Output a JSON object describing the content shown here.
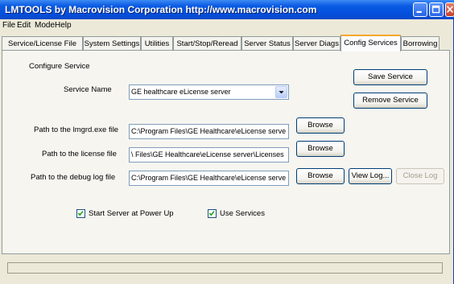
{
  "window": {
    "title": "LMTOOLS by Macrovision Corporation http://www.macrovision.com"
  },
  "menu": [
    "File",
    "Edit",
    "Mode",
    "Help"
  ],
  "tabs": [
    {
      "label": "Service/License File"
    },
    {
      "label": "System Settings"
    },
    {
      "label": "Utilities"
    },
    {
      "label": "Start/Stop/Reread"
    },
    {
      "label": "Server Status"
    },
    {
      "label": "Server Diags"
    },
    {
      "label": "Config Services",
      "active": true
    },
    {
      "label": "Borrowing"
    }
  ],
  "config": {
    "section_label": "Configure Service",
    "service_name_label": "Service Name",
    "service_name_value": "GE healthcare eLicense server",
    "save_button": "Save Service",
    "remove_button": "Remove Service",
    "lmgrd_label": "Path to the lmgrd.exe file",
    "lmgrd_value": "C:\\Program Files\\GE Healthcare\\eLicense serve",
    "license_label": "Path to the license file",
    "license_value": "\\ Files\\GE Healthcare\\eLicense server\\Licenses",
    "debug_label": "Path to the debug log file",
    "debug_value": "C:\\Program Files\\GE Healthcare\\eLicense serve",
    "browse_button": "Browse",
    "view_log_button": "View Log...",
    "close_log_button": "Close Log",
    "start_at_powerup_label": "Start Server at Power Up",
    "start_at_powerup_checked": true,
    "use_services_label": "Use Services",
    "use_services_checked": true
  },
  "status": {
    "text": ""
  }
}
